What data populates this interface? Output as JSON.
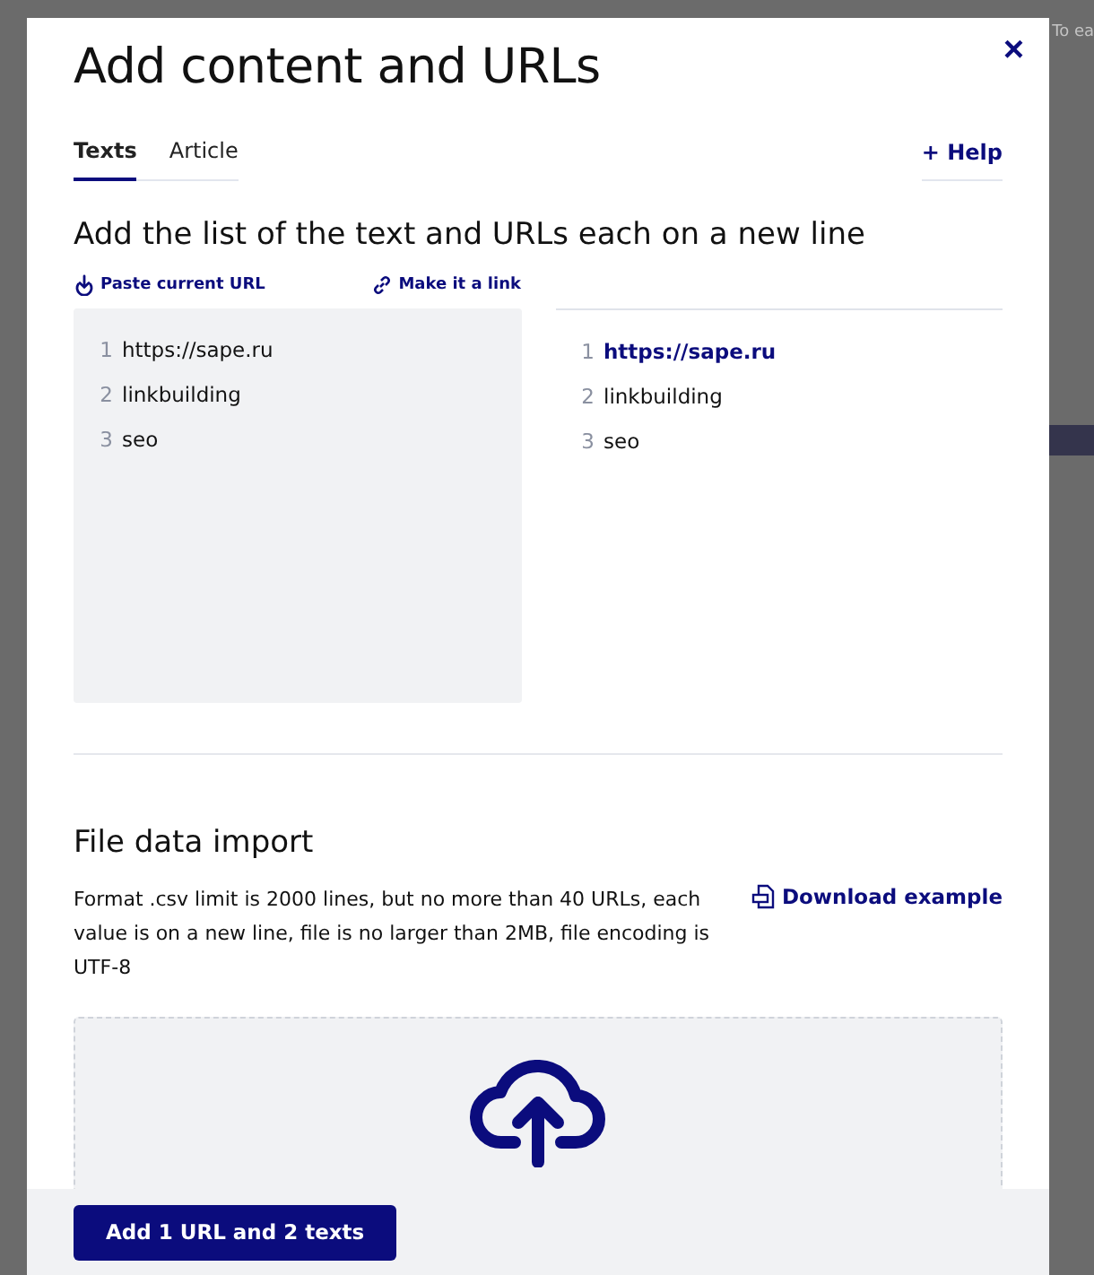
{
  "background": {
    "hint": "To ea"
  },
  "dialog": {
    "title": "Add content and URLs",
    "close": "×"
  },
  "tabs": [
    {
      "label": "Texts",
      "selected": true
    },
    {
      "label": "Article",
      "selected": false
    }
  ],
  "help": {
    "label": "Help",
    "icon": "+"
  },
  "list_section": {
    "heading": "Add the list of the text and URLs each on a new line",
    "paste_action": "Paste current URL",
    "link_action": "Make it a link"
  },
  "editor_lines": [
    {
      "number": "1",
      "text": "https://sape.ru"
    },
    {
      "number": "2",
      "text": "linkbuilding"
    },
    {
      "number": "3",
      "text": "seo"
    }
  ],
  "preview_lines": [
    {
      "number": "1",
      "text": "https://sape.ru",
      "kind": "url"
    },
    {
      "number": "2",
      "text": "linkbuilding",
      "kind": "text"
    },
    {
      "number": "3",
      "text": "seo",
      "kind": "text"
    }
  ],
  "import_section": {
    "heading": "File data import",
    "description": "Format .csv limit is 2000 lines, but no more than 40 URLs, each value is on a new line, file is no larger than 2MB, file encoding is UTF-8",
    "download": "Download example"
  },
  "submit_button": "Add 1 URL and 2 texts"
}
